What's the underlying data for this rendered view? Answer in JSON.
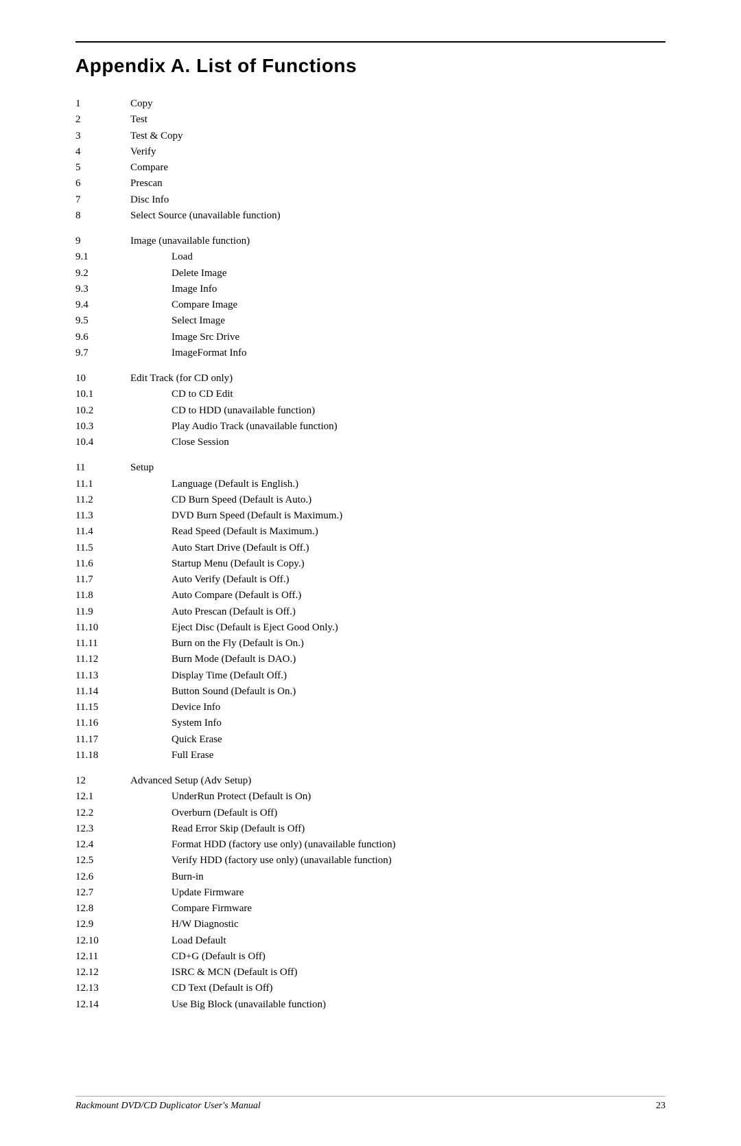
{
  "title": "Appendix A.  List of Functions",
  "sections": [
    {
      "items": [
        {
          "num": "1",
          "label": "Copy",
          "indent": false
        },
        {
          "num": "2",
          "label": "Test",
          "indent": false
        },
        {
          "num": "3",
          "label": "Test & Copy",
          "indent": false
        },
        {
          "num": "4",
          "label": "Verify",
          "indent": false
        },
        {
          "num": "5",
          "label": "Compare",
          "indent": false
        },
        {
          "num": "6",
          "label": "Prescan",
          "indent": false
        },
        {
          "num": "7",
          "label": "Disc Info",
          "indent": false
        },
        {
          "num": "8",
          "label": "Select Source (unavailable function)",
          "indent": false
        }
      ]
    },
    {
      "items": [
        {
          "num": "9",
          "label": "Image (unavailable function)",
          "indent": false
        },
        {
          "num": "9.1",
          "label": "Load",
          "indent": true
        },
        {
          "num": "9.2",
          "label": "Delete Image",
          "indent": true
        },
        {
          "num": "9.3",
          "label": "Image Info",
          "indent": true
        },
        {
          "num": "9.4",
          "label": "Compare Image",
          "indent": true
        },
        {
          "num": "9.5",
          "label": "Select Image",
          "indent": true
        },
        {
          "num": "9.6",
          "label": "Image Src Drive",
          "indent": true
        },
        {
          "num": "9.7",
          "label": "ImageFormat Info",
          "indent": true
        }
      ]
    },
    {
      "items": [
        {
          "num": "10",
          "label": "Edit Track (for CD only)",
          "indent": false
        },
        {
          "num": "10.1",
          "label": "CD to CD Edit",
          "indent": true
        },
        {
          "num": "10.2",
          "label": "CD to HDD (unavailable function)",
          "indent": true
        },
        {
          "num": "10.3",
          "label": "Play Audio Track (unavailable function)",
          "indent": true
        },
        {
          "num": "10.4",
          "label": "Close Session",
          "indent": true
        }
      ]
    },
    {
      "items": [
        {
          "num": "11",
          "label": "Setup",
          "indent": false
        },
        {
          "num": "11.1",
          "label": "Language (Default is English.)",
          "indent": true
        },
        {
          "num": "11.2",
          "label": "CD Burn Speed (Default is Auto.)",
          "indent": true
        },
        {
          "num": "11.3",
          "label": "DVD Burn Speed (Default is Maximum.)",
          "indent": true
        },
        {
          "num": "11.4",
          "label": "Read Speed (Default is Maximum.)",
          "indent": true
        },
        {
          "num": "11.5",
          "label": "Auto Start Drive (Default is Off.)",
          "indent": true
        },
        {
          "num": "11.6",
          "label": "Startup Menu (Default is Copy.)",
          "indent": true
        },
        {
          "num": "11.7",
          "label": "Auto Verify (Default is Off.)",
          "indent": true
        },
        {
          "num": "11.8",
          "label": "Auto Compare (Default is Off.)",
          "indent": true
        },
        {
          "num": "11.9",
          "label": "Auto Prescan (Default is Off.)",
          "indent": true
        },
        {
          "num": "11.10",
          "label": "Eject Disc (Default is Eject Good Only.)",
          "indent": true
        },
        {
          "num": "11.11",
          "label": "Burn on the Fly (Default is On.)",
          "indent": true
        },
        {
          "num": "11.12",
          "label": "Burn Mode (Default is DAO.)",
          "indent": true
        },
        {
          "num": "11.13",
          "label": "Display Time (Default Off.)",
          "indent": true
        },
        {
          "num": "11.14",
          "label": "Button Sound (Default is On.)",
          "indent": true
        },
        {
          "num": "11.15",
          "label": "Device Info",
          "indent": true
        },
        {
          "num": "11.16",
          "label": "System Info",
          "indent": true
        },
        {
          "num": "11.17",
          "label": "Quick Erase",
          "indent": true
        },
        {
          "num": "11.18",
          "label": "Full Erase",
          "indent": true
        }
      ]
    },
    {
      "items": [
        {
          "num": "12",
          "label": "Advanced Setup (Adv Setup)",
          "indent": false
        },
        {
          "num": "12.1",
          "label": "UnderRun Protect (Default is On)",
          "indent": true
        },
        {
          "num": "12.2",
          "label": "Overburn (Default is Off)",
          "indent": true
        },
        {
          "num": "12.3",
          "label": "Read Error Skip (Default is Off)",
          "indent": true
        },
        {
          "num": "12.4",
          "label": "Format HDD (factory use only) (unavailable function)",
          "indent": true
        },
        {
          "num": "12.5",
          "label": "Verify HDD (factory use only) (unavailable function)",
          "indent": true
        },
        {
          "num": "12.6",
          "label": "Burn-in",
          "indent": true
        },
        {
          "num": "12.7",
          "label": "Update Firmware",
          "indent": true
        },
        {
          "num": "12.8",
          "label": "Compare Firmware",
          "indent": true
        },
        {
          "num": "12.9",
          "label": "H/W Diagnostic",
          "indent": true
        },
        {
          "num": "12.10",
          "label": "Load Default",
          "indent": true
        },
        {
          "num": "12.11",
          "label": "CD+G (Default is Off)",
          "indent": true
        },
        {
          "num": "12.12",
          "label": "ISRC & MCN (Default is Off)",
          "indent": true
        },
        {
          "num": "12.13",
          "label": "CD Text (Default is Off)",
          "indent": true
        },
        {
          "num": "12.14",
          "label": "Use Big Block (unavailable function)",
          "indent": true
        }
      ]
    }
  ],
  "footer": {
    "left": "Rackmount DVD/CD Duplicator User's Manual",
    "right": "23"
  }
}
